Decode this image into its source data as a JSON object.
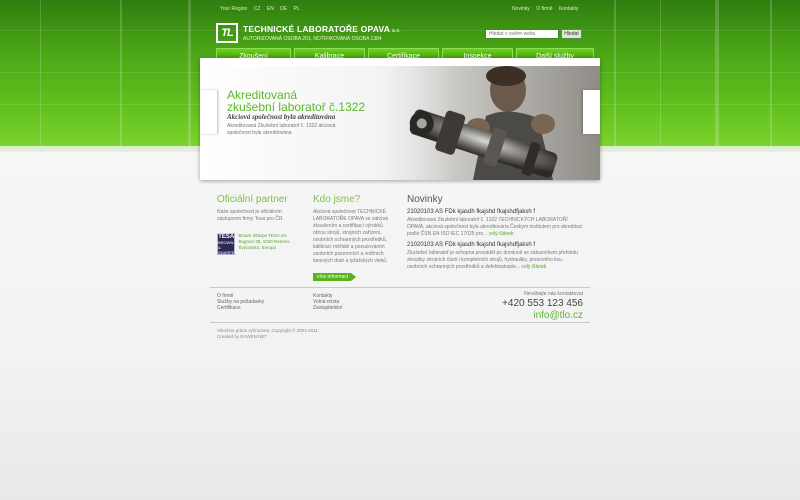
{
  "colors": {
    "brand_green": "#5bb82a",
    "nav_green": "#47a80c",
    "band_dark": "#2e7d0f"
  },
  "util_left": [
    "Your Region",
    "CZ",
    "EN",
    "DE",
    "PL"
  ],
  "util_right": [
    "Novinky",
    "O firmě",
    "Kontakty"
  ],
  "logo": {
    "mark": "TL",
    "title": "TECHNICKÉ LABORATOŘE OPAVA",
    "suffix": "a.s.",
    "subtitle": "AUTORIZOVANÁ OSOBA 201, NOTIFIKOVANÁ OSOBA 1384"
  },
  "search": {
    "placeholder": "Hledat v celém webu",
    "button": "Hledat"
  },
  "nav": [
    "Zkoušení",
    "Kalibrace",
    "Certifikace",
    "Inspekce",
    "Další služby"
  ],
  "hero": {
    "title_line1": "Akreditovaná",
    "title_line2": "zkušební laboratoř č.1322",
    "slogan": "Akciová společnost byla akreditována",
    "desc": "Akreditovaná Zkušební laboratoř č. 1322 akciová společnost byla akreditována"
  },
  "partner": {
    "heading": "Oficiální partner",
    "text": "Naše společnost je oficiálním zástupcem firmy Tesa pro ČR.",
    "logo_line1": "TESA",
    "logo_line2": "BROWN & SHARPE",
    "address": "Brown Sharpe TESA SA Bugnon 38, 1020 Renens Švýcarsko, Evropa"
  },
  "who": {
    "heading": "Kdo jsme?",
    "text": "Akciová společnost TECHNICKÉ LABORATOŘE OPAVA se zabývá zkoušením a certifikací výrobků obrou strojů, strojních zařízení, osobních ochranných prostředků, kalibrací měřidel a posuzováním osobních pozemních a vnitřních lanových drah a lyžařských vleků.",
    "more": "více informací"
  },
  "news": {
    "heading": "Novinky",
    "items": [
      {
        "title": "21020103 AS FDk  kjasdh fkajshd fkajshdfjaksh f",
        "text": "Akreditovaná Zkušební laboratoř č. 1322 TECHNICKÝCH LABORATOŘÍ OPAVA, akciová společnost byla akreditována Českým institutem pro akreditaci podle ČSN EN ISO IEC 17025 pro...",
        "more": "celý článek"
      },
      {
        "title": "21020103 AS FDk  kjasdh fkajshd fkajshdfjaksh f",
        "text": "Zkušební laboratoř je schopna provádět po domluvě se zákazníkem přehledu zkoušky strojních částí i kompletních strojů, hydrauliky, presového lisu, osobních ochranných prostředků a defektoskopie...",
        "more": "celý článek"
      }
    ]
  },
  "footer": {
    "col1": [
      "O firmě",
      "Služby na požadavky",
      "Certifikace"
    ],
    "col2": [
      "Kontakty",
      "Volná místa",
      "Zastupitelství"
    ],
    "contact_label": "Neváhejte nás kontaktovat",
    "phone": "+420 553 123 456",
    "email": "info@tlo.cz",
    "copyright": "Všechna práva vyhrazena. Copyright © 2001-2011",
    "created": "Created by RAWEN.NET"
  }
}
